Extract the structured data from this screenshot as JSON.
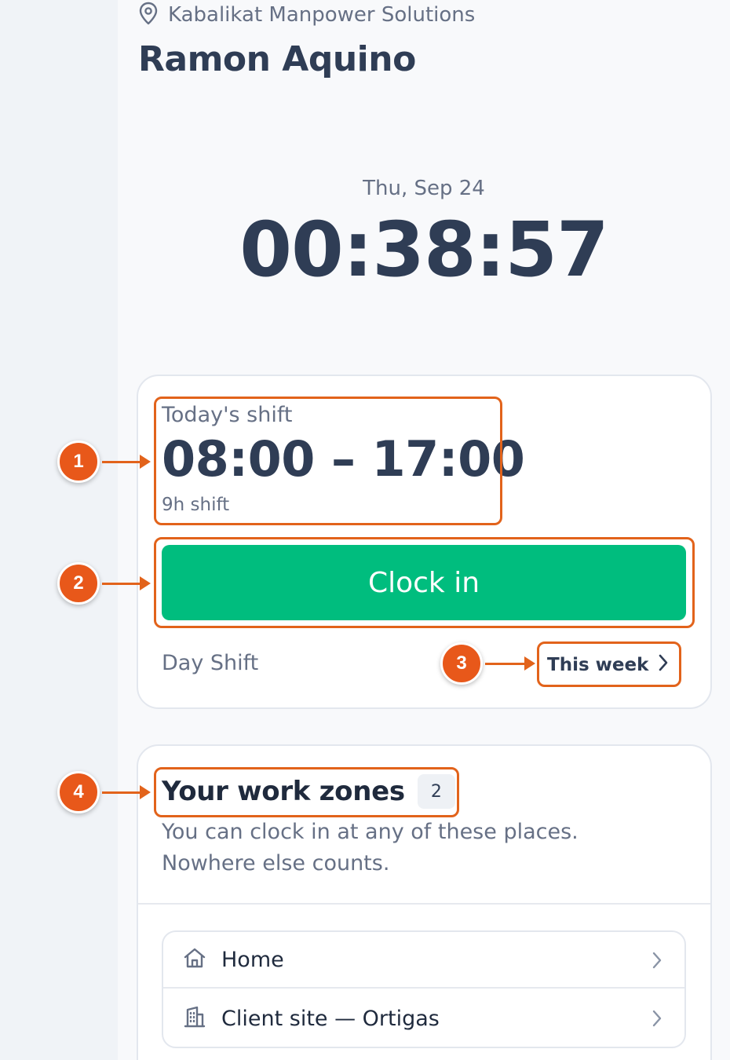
{
  "header": {
    "organization": "Kabalikat Manpower Solutions",
    "organization_icon": "location-pin-icon",
    "person_name": "Ramon Aquino"
  },
  "clock": {
    "date": "Thu, Sep 24",
    "time": "00:38:57"
  },
  "shift": {
    "label": "Today's shift",
    "time_range": "08:00 – 17:00",
    "duration": "9h shift",
    "clock_in_label": "Clock in",
    "shift_type": "Day Shift",
    "week_link_label": "This week",
    "week_link_icon": "chevron-right-icon"
  },
  "zones": {
    "title": "Your work zones",
    "count": "2",
    "description_line1": "You can clock in at any of these places.",
    "description_line2": "Nowhere else counts.",
    "items": [
      {
        "label": "Home",
        "icon": "home-icon"
      },
      {
        "label": "Client site — Ortigas",
        "icon": "building-icon"
      }
    ]
  },
  "callouts": {
    "badge_1": "1",
    "badge_2": "2",
    "badge_3": "3",
    "badge_4": "4"
  },
  "colors": {
    "accent_green": "#00bd7e",
    "callout_orange": "#e2631b",
    "text_dark": "#2f3d55",
    "text_muted": "#667085"
  }
}
